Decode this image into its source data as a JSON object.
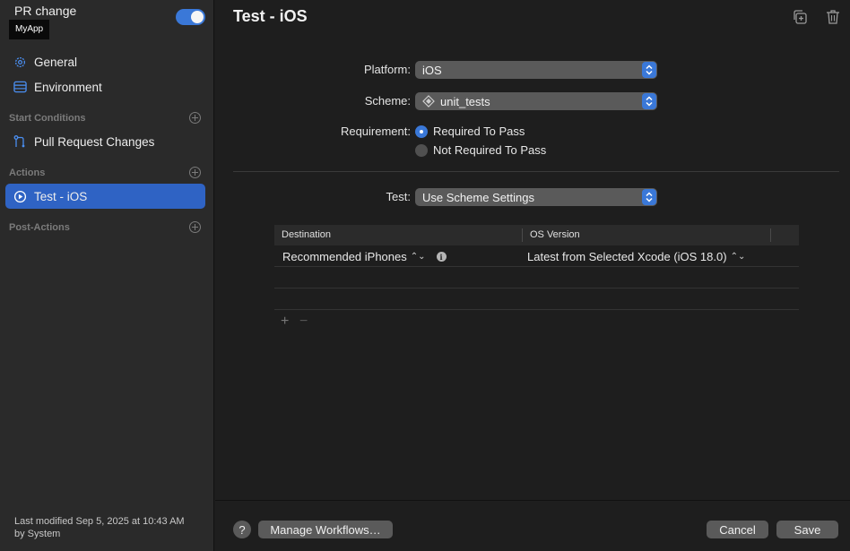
{
  "sidebar": {
    "workflow_name": "PR change",
    "product_badge": "MyApp",
    "enabled": true,
    "items": [
      {
        "label": "General",
        "icon": "gear-icon"
      },
      {
        "label": "Environment",
        "icon": "environment-icon"
      }
    ],
    "start_conditions": {
      "header": "Start Conditions",
      "items": [
        {
          "label": "Pull Request Changes",
          "icon": "branch-icon"
        }
      ]
    },
    "actions": {
      "header": "Actions",
      "items": [
        {
          "label": "Test - iOS",
          "icon": "test-icon",
          "selected": true
        }
      ]
    },
    "post_actions": {
      "header": "Post-Actions"
    },
    "last_modified": "Last modified Sep 5, 2025 at 10:43 AM",
    "modified_by": "by System"
  },
  "main": {
    "title": "Test - iOS",
    "platform": {
      "label": "Platform:",
      "value": "iOS"
    },
    "scheme": {
      "label": "Scheme:",
      "value": "unit_tests"
    },
    "requirement": {
      "label": "Requirement:",
      "options": [
        "Required To Pass",
        "Not Required To Pass"
      ],
      "selected": "Required To Pass"
    },
    "test": {
      "label": "Test:",
      "value": "Use Scheme Settings"
    },
    "table": {
      "columns": [
        "Destination",
        "OS Version"
      ],
      "rows": [
        {
          "destination": "Recommended iPhones",
          "os_version": "Latest from Selected Xcode (iOS 18.0)"
        }
      ],
      "add": "+",
      "remove": "−"
    }
  },
  "footer": {
    "help": "?",
    "manage_workflows": "Manage Workflows…",
    "cancel": "Cancel",
    "save": "Save"
  },
  "colors": {
    "accent": "#3a78d8",
    "selected_row": "#2f63c4",
    "sidebar_bg": "#2a2a2a",
    "main_bg": "#1e1e1e"
  }
}
